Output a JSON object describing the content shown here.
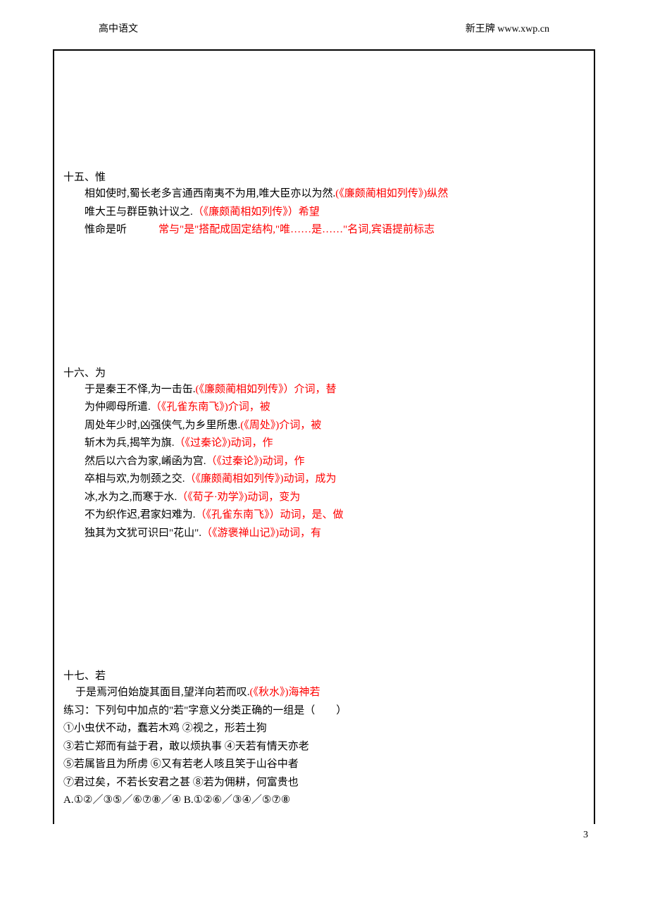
{
  "header": {
    "left": "高中语文",
    "right": "新王牌 www.xwp.cn"
  },
  "sections": [
    {
      "title": "十五、惟",
      "lines": [
        {
          "black": "相如使时,蜀长老多言通西南夷不为用,唯大臣亦以为然.",
          "red": "(《廉颇蔺相如列传》)纵然"
        },
        {
          "black": "唯大王与群臣孰计议之.",
          "red": "（《廉颇蔺相如列传》）希望"
        },
        {
          "black": "惟命是听",
          "red": "　　　常与\"是\"搭配成固定结构,\"唯……是……\"名词,宾语提前标志"
        }
      ]
    },
    {
      "title": "十六、为",
      "lines": [
        {
          "black": "于是秦王不怿,为一击缶.",
          "red": "(《廉颇蔺相如列传》）介词，替"
        },
        {
          "black": "为仲卿母所遣.",
          "red": "（《孔雀东南飞》)介词，被"
        },
        {
          "black": "周处年少时,凶强侠气,为乡里所患.",
          "red": "(《周处》)介词，被"
        },
        {
          "black": "斩木为兵,揭竿为旗.",
          "red": "（《过秦论》)动词，作"
        },
        {
          "black": "然后以六合为家,崤函为宫.",
          "red": "（《过秦论》)动词，作"
        },
        {
          "black": "卒相与欢,为刎颈之交.",
          "red": "（《廉颇蔺相如列传》)动词，成为"
        },
        {
          "black": "冰,水为之,而寒于水.",
          "red": "（《荀子·劝学》)动词，变为"
        },
        {
          "black": "不为织作迟,君家妇难为.",
          "red": "（《孔雀东南飞》）动词，是、做"
        },
        {
          "black": "独其为文犹可识曰\"花山\".",
          "red": "（《游褒禅山记》)动词，有"
        }
      ]
    },
    {
      "title": "十七、若",
      "lines": [
        {
          "black": "于是焉河伯始旋其面目,望洋向若而叹.",
          "red": "(《秋水》)海神若"
        }
      ],
      "practice": [
        "练习：下列句中加点的\"若\"字意义分类正确的一组是（　　）",
        "①小虫伏不动，蠢若木鸡 ②视之，形若土狗",
        "③若亡郑而有益于君，敢以烦执事 ④天若有情天亦老",
        "⑤若属皆且为所虏 ⑥又有若老人咳且笑于山谷中者",
        "⑦君过矣，不若长安君之甚 ⑧若为佣耕，何富贵也",
        "A.①②／③⑤／⑥⑦⑧／④ B.①②⑥／③④／⑤⑦⑧"
      ]
    }
  ],
  "pageNumber": "3"
}
